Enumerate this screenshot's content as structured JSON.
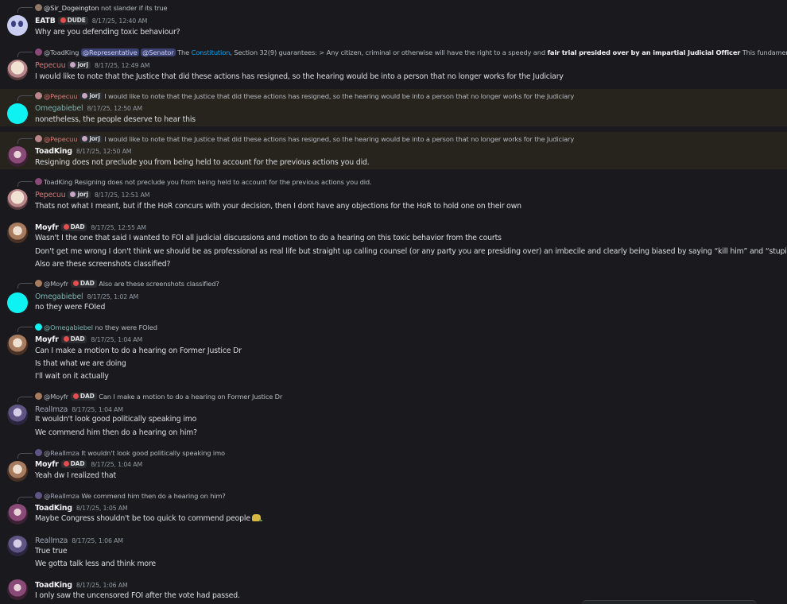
{
  "messages": [
    {
      "reply": {
        "author": "@Sir_Dogeington",
        "text": "not slander if its true"
      },
      "author": "EATB",
      "tag": "DUDE",
      "time": "8/17/25, 12:40 AM",
      "lines": [
        "Why are you defending toxic behaviour?"
      ]
    },
    {
      "reply": {
        "author": "@ToadKing",
        "mention1": "@Representative",
        "mention2": "@Senator",
        "pre": "The",
        "link": "Constitution",
        "mid": ", Section 32(9) guarantees: > Any citizen, criminal or otherwise will have the right to a speedy and",
        "bold": "fair trial presided over by an impartial Judicial Officer",
        "post": "This fundamental protection was viol"
      },
      "author": "Pepecuu",
      "tag": "jorj",
      "time": "8/17/25, 12:49 AM",
      "lines": [
        "I would like to note that the Justice that did these actions has resigned, so the hearing would be into a person that no longer works for the Judiciary"
      ]
    },
    {
      "reply": {
        "author": "@Pepecuu",
        "tag": "jorj",
        "text": "I would like to note that the Justice that did these actions has resigned, so the hearing would be into a person that no longer works for the Judiciary"
      },
      "author": "Omegabiebel",
      "time": "8/17/25, 12:50 AM",
      "lines": [
        "nonetheless, the people deserve to hear this"
      ]
    },
    {
      "reply": {
        "author": "@Pepecuu",
        "tag": "jorj",
        "text": "I would like to note that the Justice that did these actions has resigned, so the hearing would be into a person that no longer works for the Judiciary"
      },
      "author": "ToadKing",
      "time": "8/17/25, 12:50 AM",
      "lines": [
        "Resigning does not preclude you from being held to account for the previous actions you did."
      ]
    },
    {
      "reply": {
        "author": "ToadKing",
        "text": "Resigning does not preclude you from being held to account for the previous actions you did."
      },
      "author": "Pepecuu",
      "tag": "jorj",
      "time": "8/17/25, 12:51 AM",
      "lines": [
        "Thats not what I meant, but if the HoR concurs with your decision, then I dont have any objections for the HoR to hold one on their own"
      ]
    },
    {
      "author": "Moyfr",
      "tag": "DAD",
      "time": "8/17/25, 12:55 AM",
      "lines": [
        "Wasn't I the one that said I wanted to FOI all judicial discussions and motion to do a hearing on this toxic behavior from the courts",
        "Don't get me wrong I don't think we should be as professional as real life but straight up calling counsel (or any party you are presiding over) an imbecile and clearly being biased by saying “kill him” and “stupid ahh argument”",
        "Also are these screenshots classified?"
      ]
    },
    {
      "reply": {
        "author": "@Moyfr",
        "tag": "DAD",
        "text": "Also are these screenshots classified?"
      },
      "author": "Omegabiebel",
      "time": "8/17/25, 1:02 AM",
      "lines": [
        "no they were FOIed"
      ]
    },
    {
      "reply": {
        "author": "@Omegabiebel",
        "text": "no they were FOIed"
      },
      "author": "Moyfr",
      "tag": "DAD",
      "time": "8/17/25, 1:04 AM",
      "lines": [
        "Can I make a motion to do a hearing on Former Justice Dr",
        "Is that what we are doing",
        "I'll wait on it actually"
      ]
    },
    {
      "reply": {
        "author": "@Moyfr",
        "tag": "DAD",
        "text": "Can I make a motion to do a hearing on Former Justice Dr"
      },
      "author": "RealImza",
      "time": "8/17/25, 1:04 AM",
      "lines": [
        "It wouldn't look good politically speaking imo",
        "We commend him then do a hearing on him?"
      ]
    },
    {
      "reply": {
        "author": "@RealImza",
        "text": "It wouldn't look good politically speaking imo"
      },
      "author": "Moyfr",
      "tag": "DAD",
      "time": "8/17/25, 1:04 AM",
      "lines": [
        "Yeah dw I realized that"
      ]
    },
    {
      "reply": {
        "author": "@RealImza",
        "text": "We commend him then do a hearing on him?"
      },
      "author": "ToadKing",
      "time": "8/17/25, 1:05 AM",
      "lines": [
        "Maybe Congress shouldn't be too quick to commend people"
      ]
    },
    {
      "author": "RealImza",
      "time": "8/17/25, 1:06 AM",
      "lines": [
        "True true",
        "We gotta talk less and think more"
      ]
    },
    {
      "author": "ToadKing",
      "time": "8/17/25, 1:06 AM",
      "lines": [
        "I only saw the uncensored FOI after the vote had passed."
      ]
    }
  ]
}
